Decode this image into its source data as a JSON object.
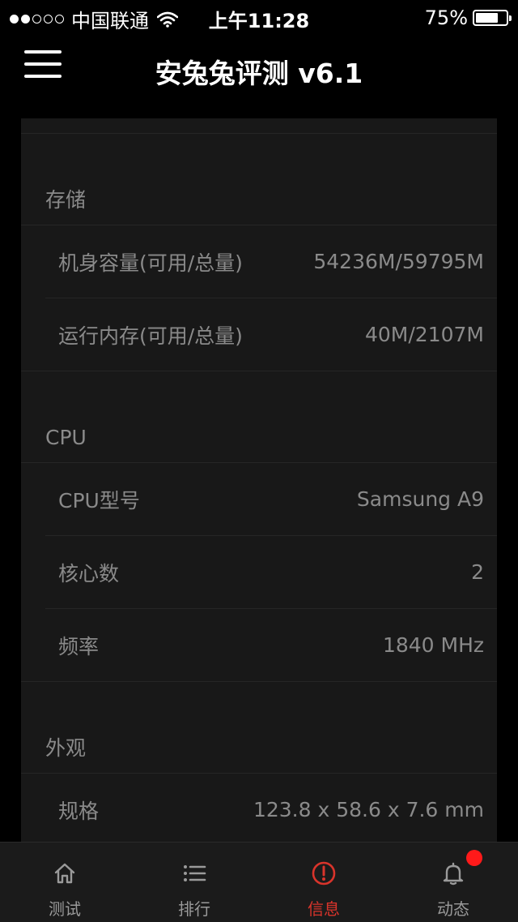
{
  "status_bar": {
    "carrier": "中国联通",
    "time": "上午11:28",
    "battery_percent": "75%",
    "battery_level": 0.75,
    "signal_bars_filled": 2,
    "signal_bars_total": 5
  },
  "nav": {
    "title": "安兔兔评测 v6.1"
  },
  "sections": {
    "storage": {
      "title": "存储",
      "rows": [
        {
          "label": "机身容量(可用/总量)",
          "value": "54236M/59795M"
        },
        {
          "label": "运行内存(可用/总量)",
          "value": "40M/2107M"
        }
      ]
    },
    "cpu": {
      "title": "CPU",
      "rows": [
        {
          "label": "CPU型号",
          "value": "Samsung A9"
        },
        {
          "label": "核心数",
          "value": "2"
        },
        {
          "label": "频率",
          "value": "1840 MHz"
        }
      ]
    },
    "appearance": {
      "title": "外观",
      "rows": [
        {
          "label": "规格",
          "value": "123.8 x 58.6 x 7.6 mm"
        }
      ]
    }
  },
  "tabs": [
    {
      "label": "测试",
      "icon": "home-icon"
    },
    {
      "label": "排行",
      "icon": "list-icon"
    },
    {
      "label": "信息",
      "icon": "info-alert-icon",
      "active": true
    },
    {
      "label": "动态",
      "icon": "bell-icon"
    }
  ],
  "colors": {
    "accent": "#d9342b",
    "badge": "#ff1a1a",
    "panel": "#181818"
  }
}
